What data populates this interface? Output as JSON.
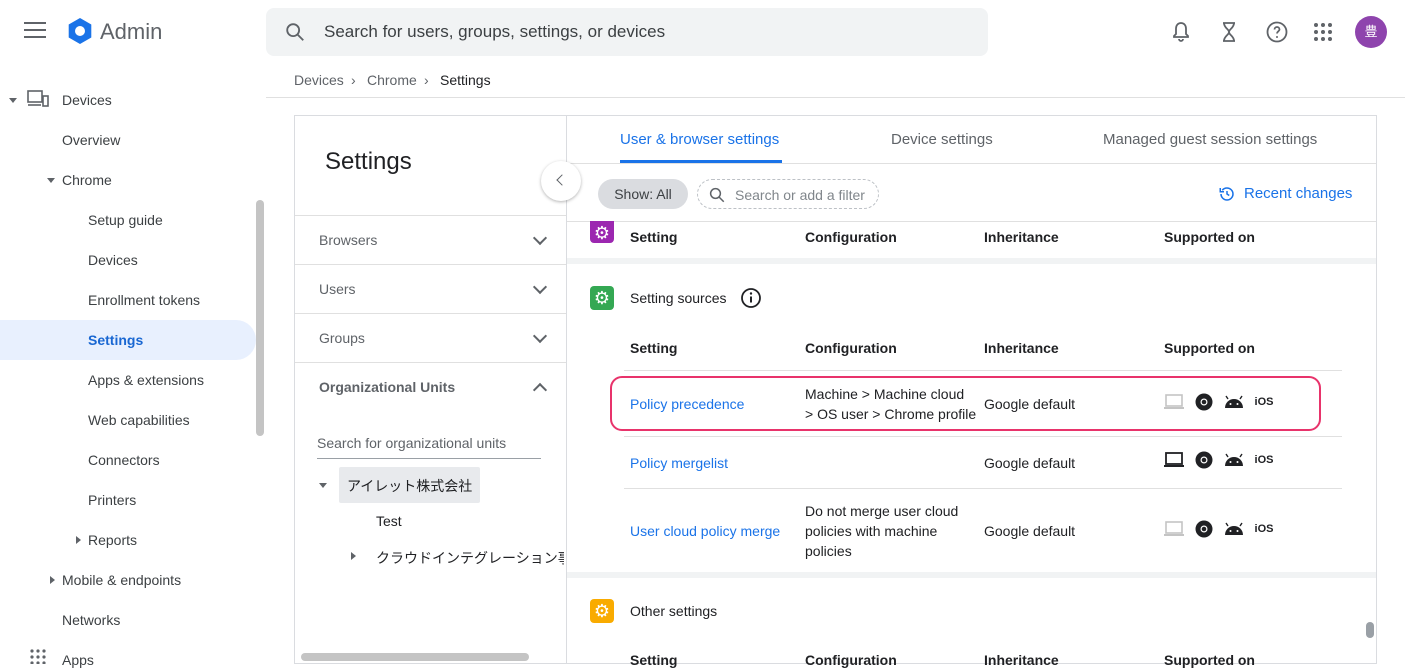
{
  "app": {
    "title": "Admin"
  },
  "search": {
    "placeholder": "Search for users, groups, settings, or devices"
  },
  "header": {
    "avatar_letter": "豊"
  },
  "sidebar": {
    "items": [
      {
        "label": "Devices"
      },
      {
        "label": "Overview"
      },
      {
        "label": "Chrome"
      },
      {
        "label": "Setup guide"
      },
      {
        "label": "Devices"
      },
      {
        "label": "Enrollment tokens"
      },
      {
        "label": "Settings"
      },
      {
        "label": "Apps & extensions"
      },
      {
        "label": "Web capabilities"
      },
      {
        "label": "Connectors"
      },
      {
        "label": "Printers"
      },
      {
        "label": "Reports"
      },
      {
        "label": "Mobile & endpoints"
      },
      {
        "label": "Networks"
      },
      {
        "label": "Apps"
      }
    ]
  },
  "breadcrumb": [
    "Devices",
    "Chrome",
    "Settings"
  ],
  "settings_panel": {
    "title": "Settings",
    "sections": [
      "Browsers",
      "Users",
      "Groups",
      "Organizational Units"
    ],
    "ou_search_placeholder": "Search for organizational units",
    "ou_tree": [
      "アイレット株式会社",
      "Test",
      "クラウドインテグレーション事"
    ]
  },
  "tabs": [
    "User & browser settings",
    "Device settings",
    "Managed guest session settings"
  ],
  "filter": {
    "chip": "Show: All",
    "placeholder": "Search or add a filter",
    "recent": "Recent changes"
  },
  "table_headers": [
    "Setting",
    "Configuration",
    "Inheritance",
    "Supported on"
  ],
  "sections": {
    "setting_sources": {
      "title": "Setting sources",
      "rows": [
        {
          "setting": "Policy precedence",
          "config_line1": "Machine > Machine cloud",
          "config_line2": "> OS user > Chrome profile",
          "inheritance": "Google default"
        },
        {
          "setting": "Policy mergelist",
          "inheritance": "Google default"
        },
        {
          "setting": "User cloud policy merge",
          "config_line1": "Do not merge user cloud",
          "config_line2": "policies with machine",
          "config_line3": "policies",
          "inheritance": "Google default"
        }
      ]
    },
    "other_settings": {
      "title": "Other settings"
    }
  },
  "supported_ios_label": "iOS",
  "colors": {
    "accent": "#1a73e8",
    "highlight": "#e8336b",
    "purple": "#9c27b0",
    "green": "#34a853",
    "orange": "#f9ab00"
  }
}
